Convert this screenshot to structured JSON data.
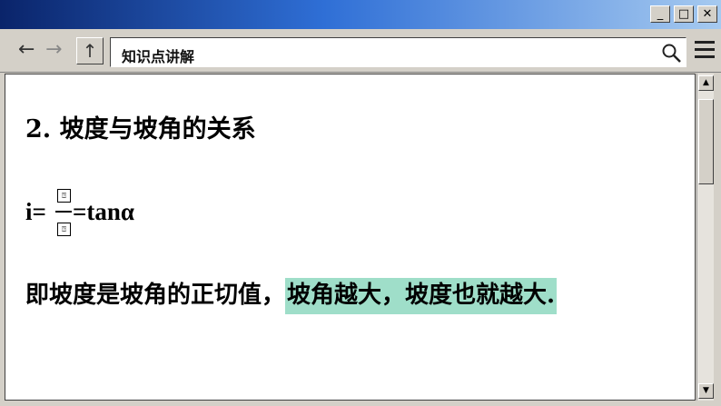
{
  "window": {
    "controls": {
      "minimize": "_",
      "maximize": "□",
      "close": "✕"
    }
  },
  "toolbar": {
    "back_icon": "←",
    "forward_icon": "→",
    "up_icon": "↑",
    "address_text": "知识点讲解",
    "search_icon": "search-icon",
    "menu_icon": "hamburger-menu-icon"
  },
  "content": {
    "heading": "2.  坡度与坡角的关系",
    "formula": {
      "lhs": "i=",
      "numerator": "⍰",
      "denominator": "⍰",
      "rhs": "=tanα"
    },
    "statement_plain": "即坡度是坡角的正切值，",
    "statement_highlight": "坡角越大，坡度也就越大.",
    "highlight_color": "#9fdec9"
  },
  "scrollbar": {
    "up_arrow": "▲",
    "down_arrow": "▼"
  }
}
